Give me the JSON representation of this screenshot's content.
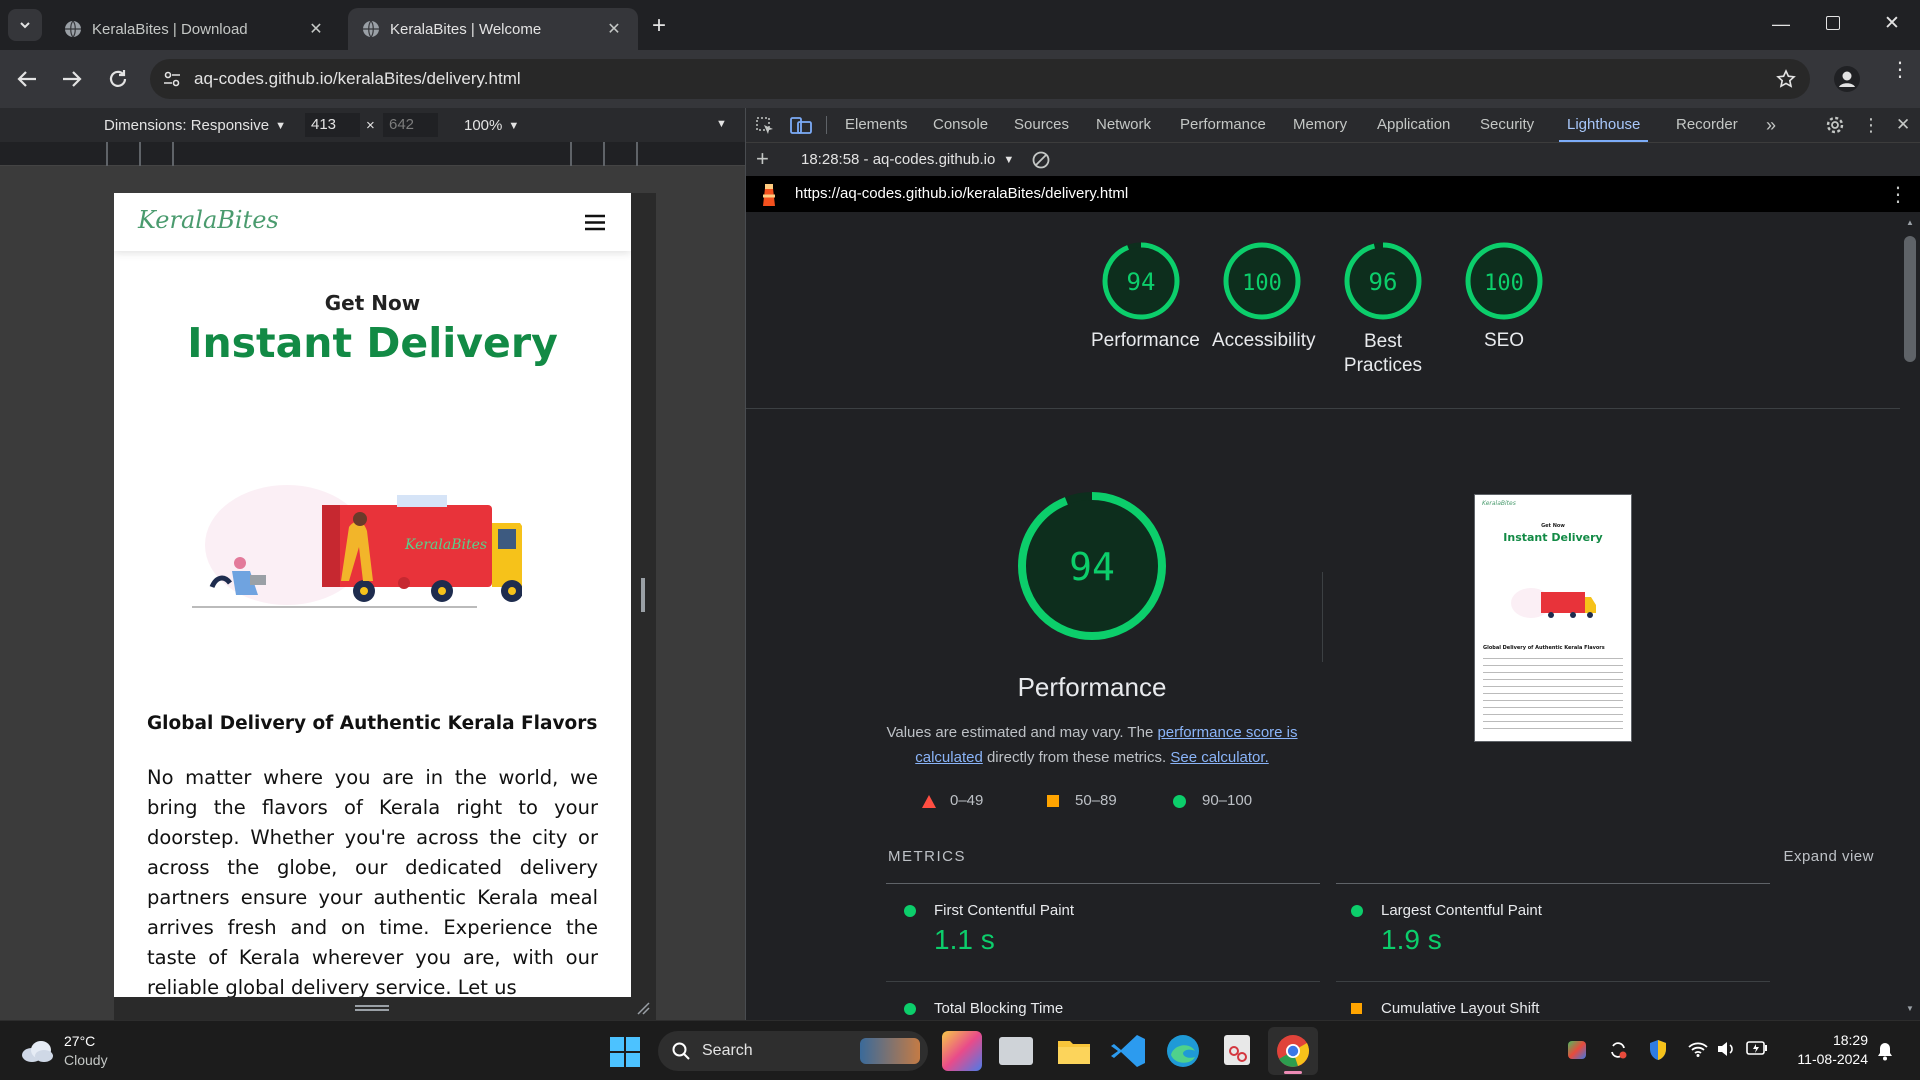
{
  "browser": {
    "tabs": [
      {
        "title": "KeralaBites | Download",
        "active": false
      },
      {
        "title": "KeralaBites | Welcome",
        "active": true
      }
    ],
    "url": "aq-codes.github.io/keralaBites/delivery.html"
  },
  "device_toolbar": {
    "dimensions_label": "Dimensions: Responsive",
    "width": "413",
    "height": "642",
    "times": "×",
    "zoom": "100%"
  },
  "site": {
    "logo": "KeralaBites",
    "hero_pre": "Get Now",
    "hero_title": "Instant Delivery",
    "truck_label": "KeralaBites",
    "section_title": "Global Delivery of Authentic Kerala Flavors",
    "paragraph": "No matter where you are in the world, we bring the flavors of Kerala right to your doorstep. Whether you're across the city or across the globe, our dedicated delivery partners ensure your authentic Kerala meal arrives fresh and on time. Experience the taste of Kerala wherever you are, with our reliable global delivery service. Let us"
  },
  "devtools": {
    "tabs": [
      "Elements",
      "Console",
      "Sources",
      "Network",
      "Performance",
      "Memory",
      "Application",
      "Security",
      "Lighthouse",
      "Recorder"
    ],
    "active_tab": "Lighthouse",
    "report_label": "18:28:58 - aq-codes.github.io",
    "report_url": "https://aq-codes.github.io/keralaBites/delivery.html"
  },
  "lighthouse": {
    "scores": [
      {
        "label": "Performance",
        "value": "94",
        "fraction": 0.94
      },
      {
        "label": "Accessibility",
        "value": "100",
        "fraction": 1.0
      },
      {
        "label": "Best Practices",
        "value": "96",
        "fraction": 0.96
      },
      {
        "label": "SEO",
        "value": "100",
        "fraction": 1.0
      }
    ],
    "main_score": "94",
    "main_fraction": 0.94,
    "main_label": "Performance",
    "desc_pre": "Values are estimated and may vary. The ",
    "desc_link1": "performance score is calculated",
    "desc_mid": " directly from these metrics. ",
    "desc_link2": "See calculator.",
    "legend": [
      "0–49",
      "50–89",
      "90–100"
    ],
    "metrics_heading": "METRICS",
    "expand_view": "Expand view",
    "metrics": [
      {
        "name": "First Contentful Paint",
        "value": "1.1 s",
        "status": "pass"
      },
      {
        "name": "Largest Contentful Paint",
        "value": "1.9 s",
        "status": "pass"
      },
      {
        "name": "Total Blocking Time",
        "value": "",
        "status": "pass"
      },
      {
        "name": "Cumulative Layout Shift",
        "value": "",
        "status": "average"
      }
    ],
    "thumb": {
      "logo": "KeralaBites",
      "pre": "Get Now",
      "title": "Instant Delivery",
      "section": "Global Delivery of Authentic Kerala Flavors"
    },
    "colors": {
      "pass": "#0cce6b",
      "average": "#ffa400",
      "fail": "#ff4e42"
    }
  },
  "taskbar": {
    "temperature": "27°C",
    "weather": "Cloudy",
    "search_placeholder": "Search",
    "time": "18:29",
    "date": "11-08-2024"
  }
}
